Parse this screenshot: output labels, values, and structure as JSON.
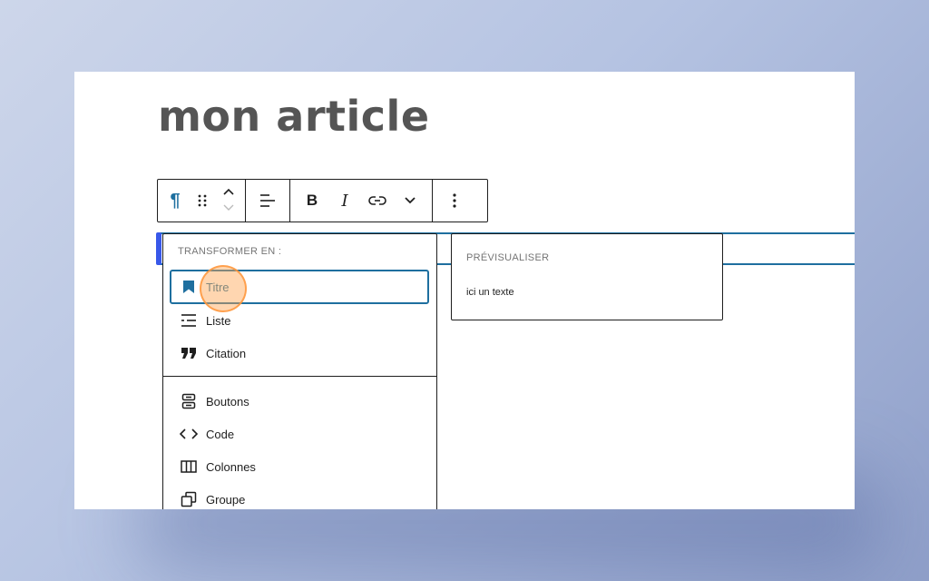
{
  "post": {
    "title": "mon article"
  },
  "toolbar": {
    "paragraph_icon": "¶",
    "bold_label": "B",
    "italic_label": "I"
  },
  "transform_menu": {
    "heading": "TRANSFORMER EN :",
    "items": [
      {
        "label": "Titre",
        "icon": "bookmark-icon",
        "active": true
      },
      {
        "label": "Liste",
        "icon": "list-icon"
      },
      {
        "label": "Citation",
        "icon": "quote-icon"
      },
      {
        "label": "Boutons",
        "icon": "buttons-icon"
      },
      {
        "label": "Code",
        "icon": "code-icon"
      },
      {
        "label": "Colonnes",
        "icon": "columns-icon"
      },
      {
        "label": "Groupe",
        "icon": "group-icon"
      }
    ]
  },
  "preview": {
    "heading": "PRÉVISUALISER",
    "text": "ici un texte"
  },
  "colors": {
    "accent": "#1e6f9f",
    "text": "#1e1e1e",
    "muted": "#757575",
    "highlight": "#ffa550"
  }
}
